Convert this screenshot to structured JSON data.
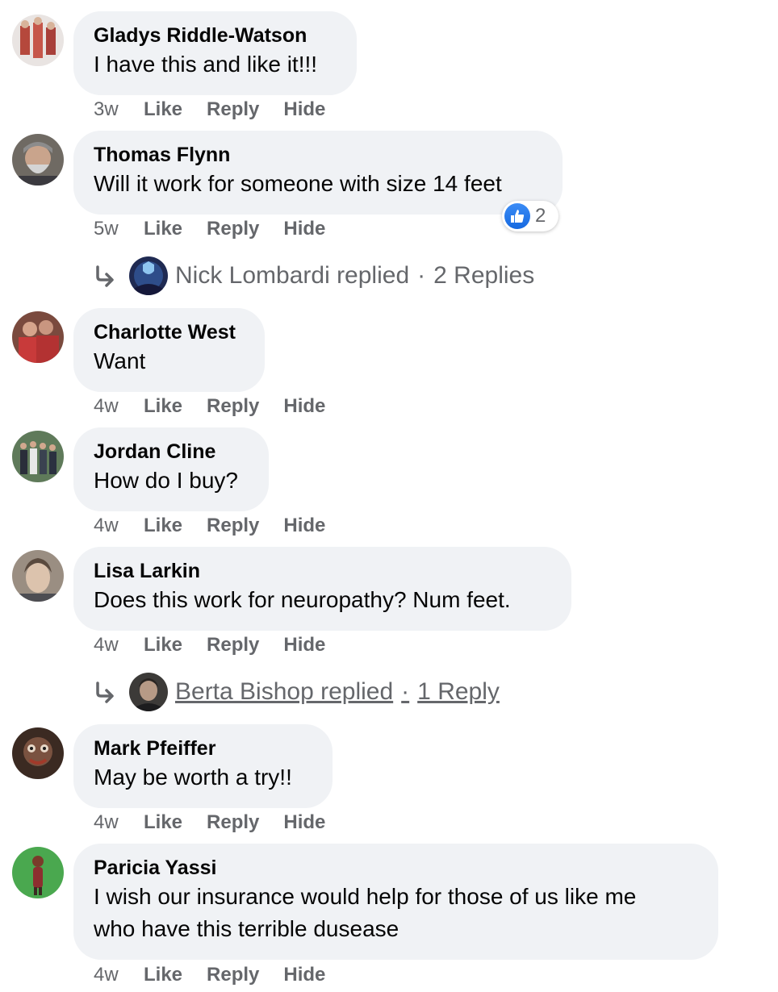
{
  "comments": [
    {
      "name": "Gladys Riddle-Watson",
      "lines": [
        "I have this and like it!!!"
      ],
      "time": "3w",
      "like": "Like",
      "reply": "Reply",
      "hide": "Hide"
    },
    {
      "name": "Thomas Flynn",
      "lines": [
        "Will it work for someone with size 14 feet"
      ],
      "time": "5w",
      "like": "Like",
      "reply": "Reply",
      "hide": "Hide",
      "reaction_count": "2",
      "reaction_icon": "thumbs-up-icon"
    },
    {
      "name": "Charlotte West",
      "lines": [
        "Want"
      ],
      "time": "4w",
      "like": "Like",
      "reply": "Reply",
      "hide": "Hide"
    },
    {
      "name": "Jordan Cline",
      "lines": [
        "How do I buy?"
      ],
      "time": "4w",
      "like": "Like",
      "reply": "Reply",
      "hide": "Hide"
    },
    {
      "name": "Lisa Larkin",
      "lines": [
        "Does this work for neuropathy? Num feet."
      ],
      "time": "4w",
      "like": "Like",
      "reply": "Reply",
      "hide": "Hide"
    },
    {
      "name": "Mark Pfeiffer",
      "lines": [
        "May be worth a try!!"
      ],
      "time": "4w",
      "like": "Like",
      "reply": "Reply",
      "hide": "Hide"
    },
    {
      "name": "Paricia Yassi",
      "lines": [
        "I wish our insurance would help for those of us like me",
        "who have this terrible dusease"
      ],
      "time": "4w",
      "like": "Like",
      "reply": "Reply",
      "hide": "Hide"
    }
  ],
  "reply_threads": [
    {
      "text": "Nick Lombardi replied",
      "separator": "·",
      "count_text": "2 Replies"
    },
    {
      "text": "Berta Bishop replied",
      "separator": "·",
      "count_text": "1 Reply"
    }
  ],
  "colors": {
    "bubble": "#f0f2f5",
    "meta_text": "#65676b",
    "like_blue": "#1877f2"
  }
}
